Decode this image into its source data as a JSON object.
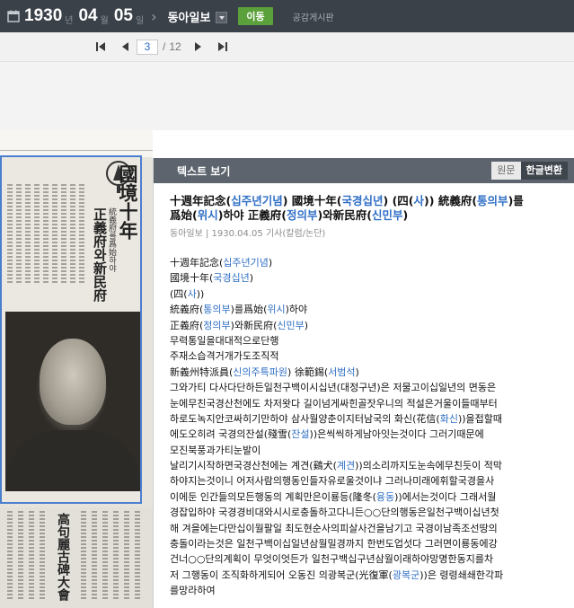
{
  "topbar": {
    "year": "1930",
    "year_unit": "년",
    "month": "04",
    "month_unit": "월",
    "day": "05",
    "day_unit": "일",
    "newspaper": "동아일보",
    "go_label": "이동",
    "board_label": "공감게시판"
  },
  "pager": {
    "current": "3",
    "separator": "/",
    "total": "12"
  },
  "panel": {
    "title": "텍스트 보기",
    "tab_original": "원문",
    "tab_korean": "한글변환"
  },
  "article": {
    "title_line1": [
      {
        "t": "十週年記念("
      },
      {
        "t": "십주년기념",
        "h": true
      },
      {
        "t": ") 國境十年("
      },
      {
        "t": "국경십년",
        "h": true
      },
      {
        "t": ") (四("
      },
      {
        "t": "사",
        "h": true
      },
      {
        "t": ")) 統義府("
      },
      {
        "t": "통의부",
        "h": true
      },
      {
        "t": ")를"
      }
    ],
    "title_line2": [
      {
        "t": "爲始("
      },
      {
        "t": "위시",
        "h": true
      },
      {
        "t": ")하야 正義府("
      },
      {
        "t": "정의부",
        "h": true
      },
      {
        "t": ")와新民府("
      },
      {
        "t": "신민부",
        "h": true
      },
      {
        "t": ")"
      }
    ],
    "meta": "동아일보 | 1930.04.05 기사(칼럼/논단)",
    "body": [
      [
        {
          "t": "十週年記念("
        },
        {
          "t": "십주년기념",
          "h": true
        },
        {
          "t": ")"
        }
      ],
      [
        {
          "t": "國境十年("
        },
        {
          "t": "국경십년",
          "h": true
        },
        {
          "t": ")"
        }
      ],
      [
        {
          "t": "(四("
        },
        {
          "t": "사",
          "h": true
        },
        {
          "t": "))"
        }
      ],
      [
        {
          "t": "統義府("
        },
        {
          "t": "통의부",
          "h": true
        },
        {
          "t": ")를爲始("
        },
        {
          "t": "위시",
          "h": true
        },
        {
          "t": ")하야"
        }
      ],
      [
        {
          "t": "正義府("
        },
        {
          "t": "정의부",
          "h": true
        },
        {
          "t": ")와新民府("
        },
        {
          "t": "신민부",
          "h": true
        },
        {
          "t": ")"
        }
      ],
      [
        {
          "t": "무력통일을대대적으로단행"
        }
      ],
      [
        {
          "t": "주재소습격거개가도조직적"
        }
      ],
      [
        {
          "t": "新義州特派員("
        },
        {
          "t": "신의주특파원",
          "h": true
        },
        {
          "t": ") 徐範錫("
        },
        {
          "t": "서범석",
          "h": true
        },
        {
          "t": ")"
        }
      ],
      [
        {
          "t": "그와가티 다사다단하든일천구백이시십년(대정구년)은 저물고이십일년의 면동은"
        }
      ],
      [
        {
          "t": "눈에무친국경산천에도 차저왓다 길이넘게싸힌골잣우니의 적설은거울이들때부터"
        }
      ],
      [
        {
          "t": "하로도녹지안코싸히기만하야 삼사월양춘이지터남국의 화신(花信("
        },
        {
          "t": "화신",
          "h": true
        },
        {
          "t": "))을접할때"
        }
      ],
      [
        {
          "t": "에도오히려 국경의잔설(殘雪("
        },
        {
          "t": "잔설",
          "h": true
        },
        {
          "t": "))은씩씩하게남아잇는것이다 그러기때문에"
        }
      ],
      [
        {
          "t": "모진북풍과가티눈발이"
        }
      ],
      [
        {
          "t": "날리기시작하면국경산천에는 계견(鷄犬("
        },
        {
          "t": "계견",
          "h": true
        },
        {
          "t": "))의소리까지도눈속에무친듯이 적막"
        }
      ],
      [
        {
          "t": "하야지는것이니 어저사람의행동인들자유로울것이냐 그러나미래에휘할국경을사"
        }
      ],
      [
        {
          "t": "이에둔 인간들의모든행동의 계획만은이룡등(隆冬("
        },
        {
          "t": "융동",
          "h": true
        },
        {
          "t": "))에서는것이다 그래서월"
        }
      ],
      [
        {
          "t": "경잡입하야 국경경비대와시시로충돌하고다니든○○단의행동은일천구백이십년첫"
        }
      ],
      [
        {
          "t": "해 겨을에는다만십이월팔일 최도현순사의피살사건을남기고 국경이남족조선땅의"
        }
      ],
      [
        {
          "t": "충돌이라는것은 일천구백이십일년삼월밀경까지 한번도업섯다 그러면이룡동에강"
        }
      ],
      [
        {
          "t": "건너○○단의계획이 무엇이엇든가 일천구백십구년삼월이래하야망명한동지를차"
        }
      ],
      [
        {
          "t": "저 그행동이 조직화하게되어 오동진 의광복군(光復軍("
        },
        {
          "t": "광복군",
          "h": true
        },
        {
          "t": "))은 령령쇄쇄한각파"
        }
      ],
      [
        {
          "t": "를망라하여"
        }
      ]
    ]
  },
  "newspaper_scan": {
    "headline_main": "國境十年",
    "headline_sub": "正義府와新民府",
    "headline_small": "統義府를爲始하야",
    "lower_headline": "高句麗古碑大會"
  }
}
